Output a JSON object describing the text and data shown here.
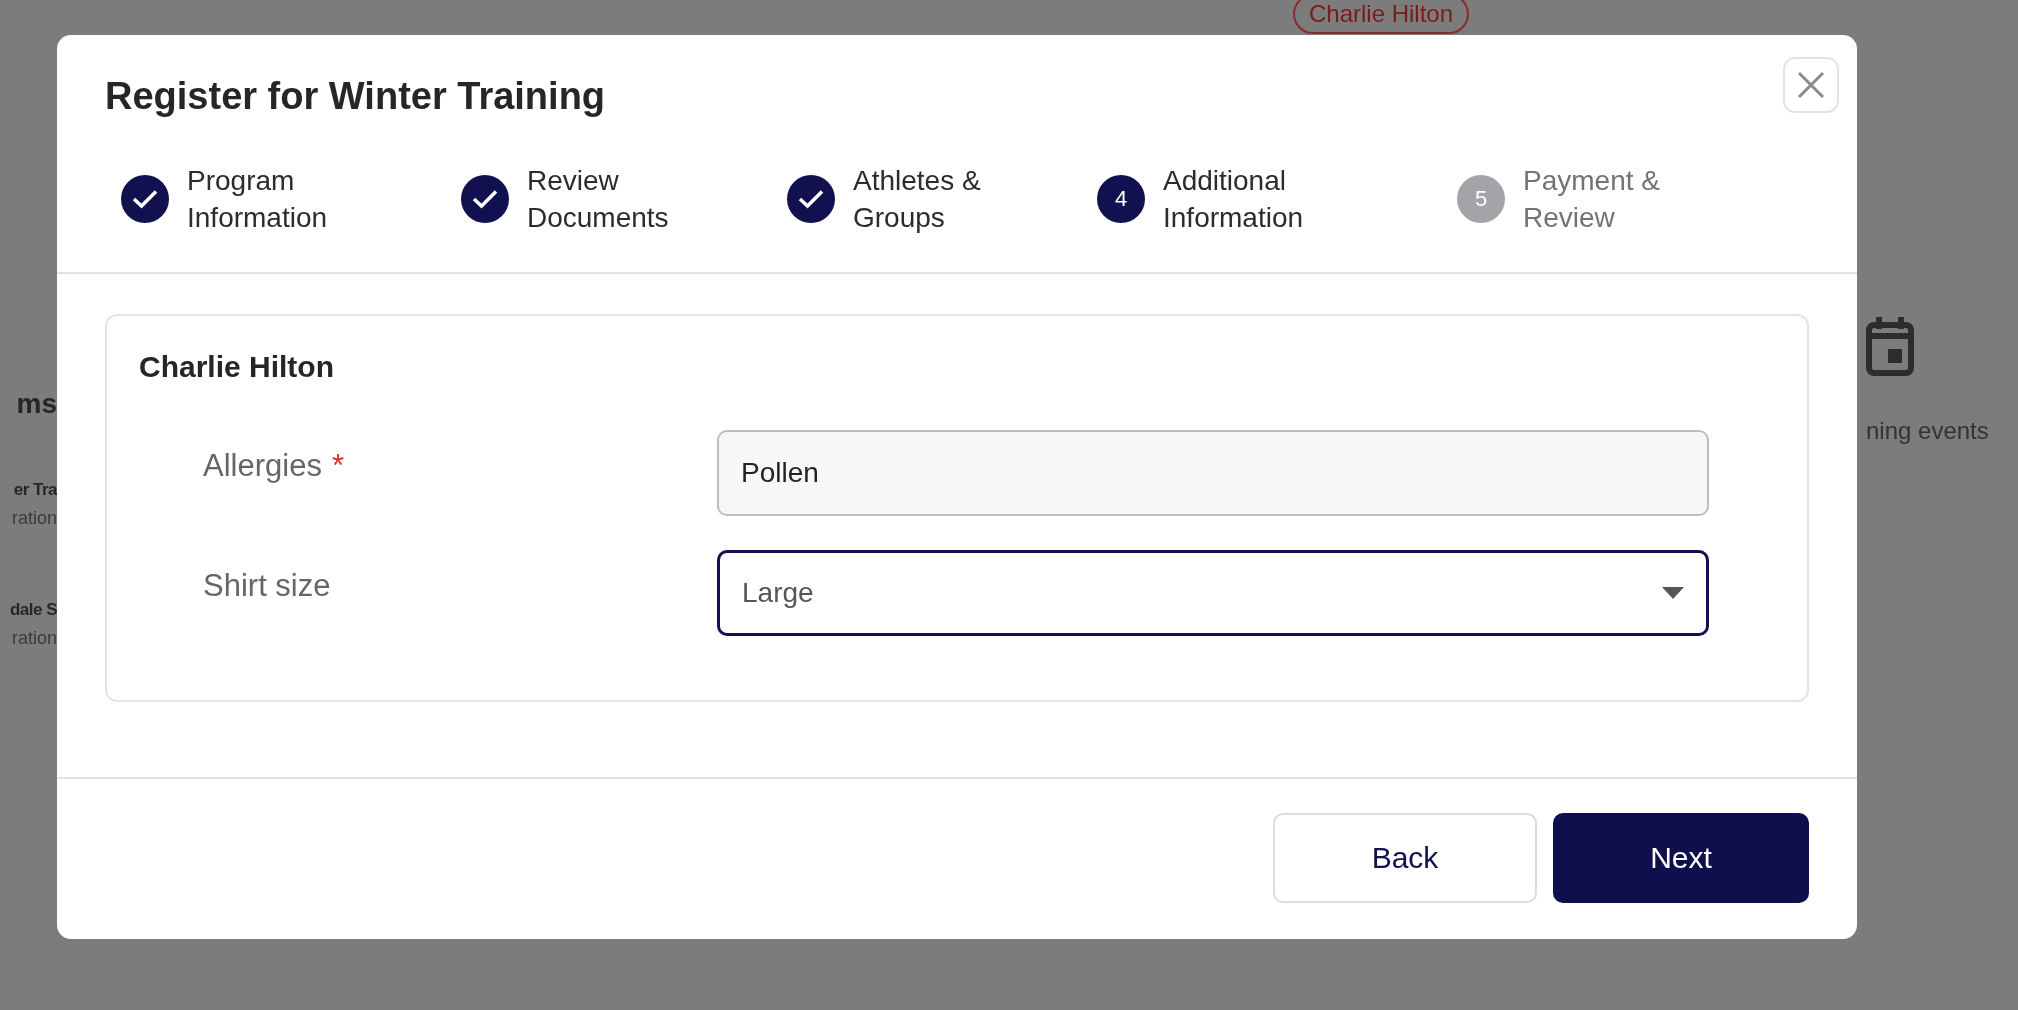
{
  "background": {
    "badge": "Charlie Hilton",
    "left_heading": "ms",
    "left_items": [
      {
        "title": "er Tra",
        "subtitle": "ration"
      },
      {
        "title": "dale S",
        "subtitle": "ration"
      }
    ],
    "right_caption": "ning events"
  },
  "dialog": {
    "title": "Register for Winter Training",
    "steps": [
      {
        "label": "Program Information",
        "completed": true
      },
      {
        "label": "Review Documents",
        "completed": true
      },
      {
        "label": "Athletes & Groups",
        "completed": true
      },
      {
        "label": "Additional Information",
        "completed": false,
        "active": true,
        "number": "4"
      },
      {
        "label": "Payment & Review",
        "completed": false,
        "active": false,
        "number": "5"
      }
    ],
    "athlete": "Charlie Hilton",
    "fields": [
      {
        "label": "Allergies",
        "required_mark": "*",
        "kind": "text",
        "value": "Pollen",
        "focused": false
      },
      {
        "label": "Shirt size",
        "kind": "select",
        "value": "Large",
        "focused": true
      }
    ],
    "buttons": [
      {
        "label": "Back",
        "primary": false
      },
      {
        "label": "Next",
        "primary": true
      }
    ]
  }
}
